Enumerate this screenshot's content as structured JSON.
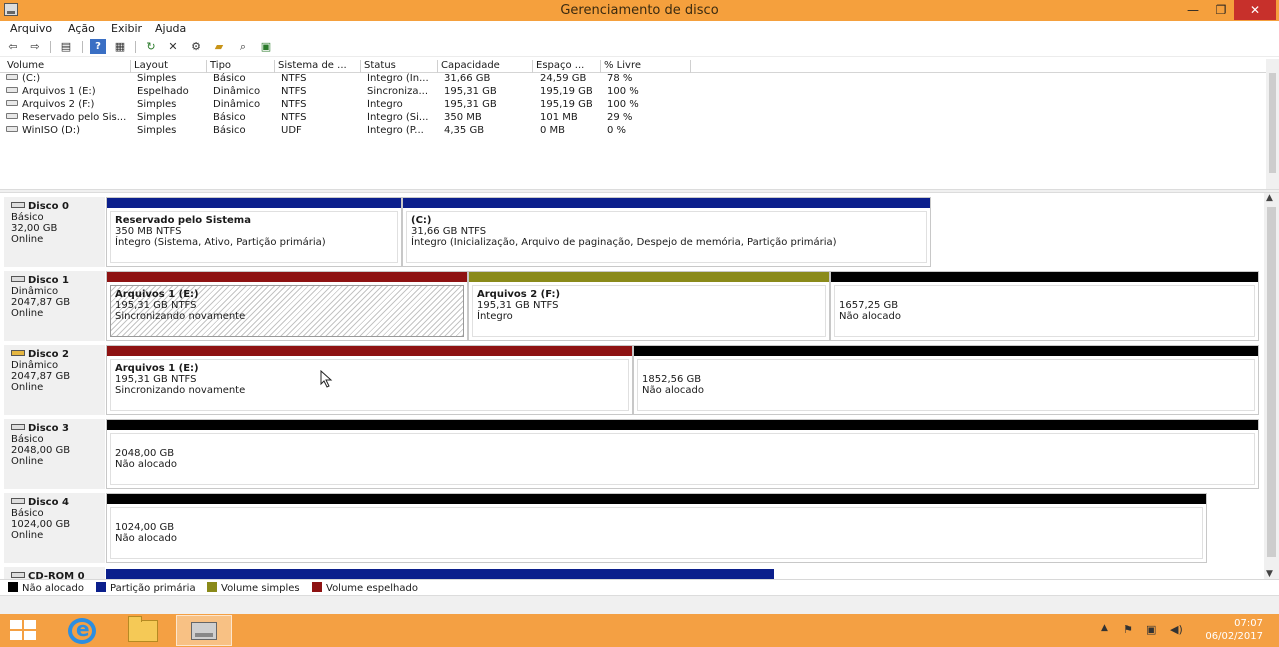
{
  "window": {
    "title": "Gerenciamento de disco",
    "min": "—",
    "max": "❐",
    "close": "✕"
  },
  "menu": [
    "Arquivo",
    "Ação",
    "Exibir",
    "Ajuda"
  ],
  "toolbar_icons": [
    "back-arrow-icon",
    "forward-arrow-icon",
    "properties-icon",
    "help-icon",
    "view-icon",
    "refresh-icon",
    "delete-icon",
    "settings-icon",
    "open-folder-icon",
    "search-icon",
    "rescan-icon"
  ],
  "volume_list": {
    "columns": [
      "Volume",
      "Layout",
      "Tipo",
      "Sistema de ...",
      "Status",
      "Capacidade",
      "Espaço ...",
      "% Livre"
    ],
    "rows": [
      [
        "(C:)",
        "Simples",
        "Básico",
        "NTFS",
        "Íntegro (In...",
        "31,66 GB",
        "24,59 GB",
        "78 %"
      ],
      [
        "Arquivos 1 (E:)",
        "Espelhado",
        "Dinâmico",
        "NTFS",
        "Sincroniza...",
        "195,31 GB",
        "195,19 GB",
        "100 %"
      ],
      [
        "Arquivos 2 (F:)",
        "Simples",
        "Dinâmico",
        "NTFS",
        "Íntegro",
        "195,31 GB",
        "195,19 GB",
        "100 %"
      ],
      [
        "Reservado pelo Sis...",
        "Simples",
        "Básico",
        "NTFS",
        "Íntegro (Si...",
        "350 MB",
        "101 MB",
        "29 %"
      ],
      [
        "WinISO (D:)",
        "Simples",
        "Básico",
        "UDF",
        "Íntegro (P...",
        "4,35 GB",
        "0 MB",
        "0 %"
      ]
    ]
  },
  "disks": [
    {
      "name": "Disco 0",
      "type": "Básico",
      "size": "32,00 GB",
      "state": "Online",
      "parts": [
        {
          "title": "Reservado pelo Sistema",
          "size": "350 MB NTFS",
          "status": "Íntegro (Sistema, Ativo, Partição primária)"
        },
        {
          "title": "(C:)",
          "size": "31,66 GB NTFS",
          "status": "Íntegro (Inicialização, Arquivo de paginação, Despejo de memória, Partição primária)"
        }
      ]
    },
    {
      "name": "Disco 1",
      "type": "Dinâmico",
      "size": "2047,87 GB",
      "state": "Online",
      "parts": [
        {
          "title": "Arquivos 1  (E:)",
          "size": "195,31 GB NTFS",
          "status": "Sincronizando novamente"
        },
        {
          "title": "Arquivos 2  (F:)",
          "size": "195,31 GB NTFS",
          "status": "Íntegro"
        },
        {
          "title": "",
          "size": "1657,25 GB",
          "status": "Não alocado"
        }
      ]
    },
    {
      "name": "Disco 2",
      "type": "Dinâmico",
      "size": "2047,87 GB",
      "state": "Online",
      "parts": [
        {
          "title": "Arquivos 1  (E:)",
          "size": "195,31 GB NTFS",
          "status": "Sincronizando novamente"
        },
        {
          "title": "",
          "size": "1852,56 GB",
          "status": "Não alocado"
        }
      ]
    },
    {
      "name": "Disco 3",
      "type": "Básico",
      "size": "2048,00 GB",
      "state": "Online",
      "parts": [
        {
          "title": "",
          "size": "2048,00 GB",
          "status": "Não alocado"
        }
      ]
    },
    {
      "name": "Disco 4",
      "type": "Básico",
      "size": "1024,00 GB",
      "state": "Online",
      "parts": [
        {
          "title": "",
          "size": "1024,00 GB",
          "status": "Não alocado"
        }
      ]
    },
    {
      "name": "CD-ROM 0"
    }
  ],
  "legend": [
    "Não alocado",
    "Partição primária",
    "Volume simples",
    "Volume espelhado"
  ],
  "colors": {
    "unallocated": "#000000",
    "primary": "#0b1f8c",
    "simple": "#8a8a1a",
    "mirrored": "#8e1212",
    "accent": "#f5a03d"
  },
  "taskbar": {
    "time": "07:07",
    "date": "06/02/2017"
  }
}
